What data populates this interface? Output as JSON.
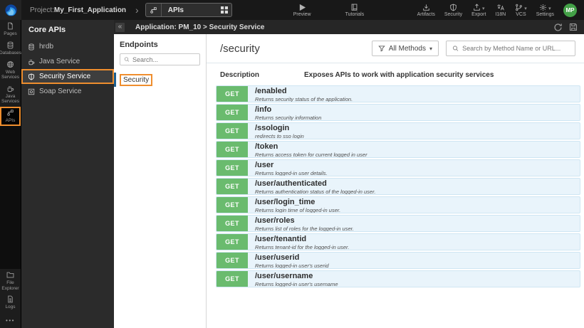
{
  "topbar": {
    "project_label": "Project:",
    "project_name": "My_First_Application",
    "tab_label": "APIs",
    "preview_label": "Preview",
    "tutorials_label": "Tutorials",
    "actions": [
      {
        "label": "Artifacts"
      },
      {
        "label": "Security"
      },
      {
        "label": "Export"
      },
      {
        "label": "I18N"
      },
      {
        "label": "VCS"
      },
      {
        "label": "Settings"
      }
    ],
    "avatar_initials": "MP"
  },
  "sidebar": {
    "top_items": [
      {
        "label": "Pages"
      },
      {
        "label": "Databases"
      },
      {
        "label": "Web Services"
      },
      {
        "label": "Java Services"
      },
      {
        "label": "APIs"
      }
    ],
    "bottom_items": [
      {
        "label": "File Explorer"
      },
      {
        "label": "Logs"
      }
    ],
    "more_label": "•••"
  },
  "core_apis": {
    "title": "Core APIs",
    "collapse_glyph": "«",
    "items": [
      {
        "label": "hrdb"
      },
      {
        "label": "Java Service"
      },
      {
        "label": "Security Service"
      },
      {
        "label": "Soap Service"
      }
    ]
  },
  "app_bar": {
    "breadcrumb": "Application: PM_10 > Security Service"
  },
  "endpoints_panel": {
    "title": "Endpoints",
    "search_placeholder": "Search...",
    "items": [
      {
        "label": "Security"
      }
    ]
  },
  "main": {
    "service_path": "/security",
    "methods_filter_label": "All Methods",
    "search_placeholder": "Search by Method Name or URL...",
    "description_label": "Description",
    "description_text": "Exposes APIs to work with application security services",
    "endpoints": [
      {
        "method": "GET",
        "path": "/enabled",
        "desc": "Returns security status of the application."
      },
      {
        "method": "GET",
        "path": "/info",
        "desc": "Returns security information"
      },
      {
        "method": "GET",
        "path": "/ssologin",
        "desc": "redirects to sso login"
      },
      {
        "method": "GET",
        "path": "/token",
        "desc": "Returns access token for current logged in user"
      },
      {
        "method": "GET",
        "path": "/user",
        "desc": "Returns logged-in user details."
      },
      {
        "method": "GET",
        "path": "/user/authenticated",
        "desc": "Returns authentication status of the logged-in user."
      },
      {
        "method": "GET",
        "path": "/user/login_time",
        "desc": "Returns login time of logged-in user."
      },
      {
        "method": "GET",
        "path": "/user/roles",
        "desc": "Returns list of roles for the logged-in user."
      },
      {
        "method": "GET",
        "path": "/user/tenantid",
        "desc": "Returns tenant-id for the logged-in user."
      },
      {
        "method": "GET",
        "path": "/user/userid",
        "desc": "Returns logged-in user's userid"
      },
      {
        "method": "GET",
        "path": "/user/username",
        "desc": "Returns logged-in user's username"
      }
    ]
  },
  "colors": {
    "annotation_orange": "#ef8e2e",
    "get_badge_green": "#6abb6e",
    "endpoint_row_blue": "#e9f4fb",
    "selection_blue": "#1d5f8f",
    "avatar_green": "#43a047"
  }
}
